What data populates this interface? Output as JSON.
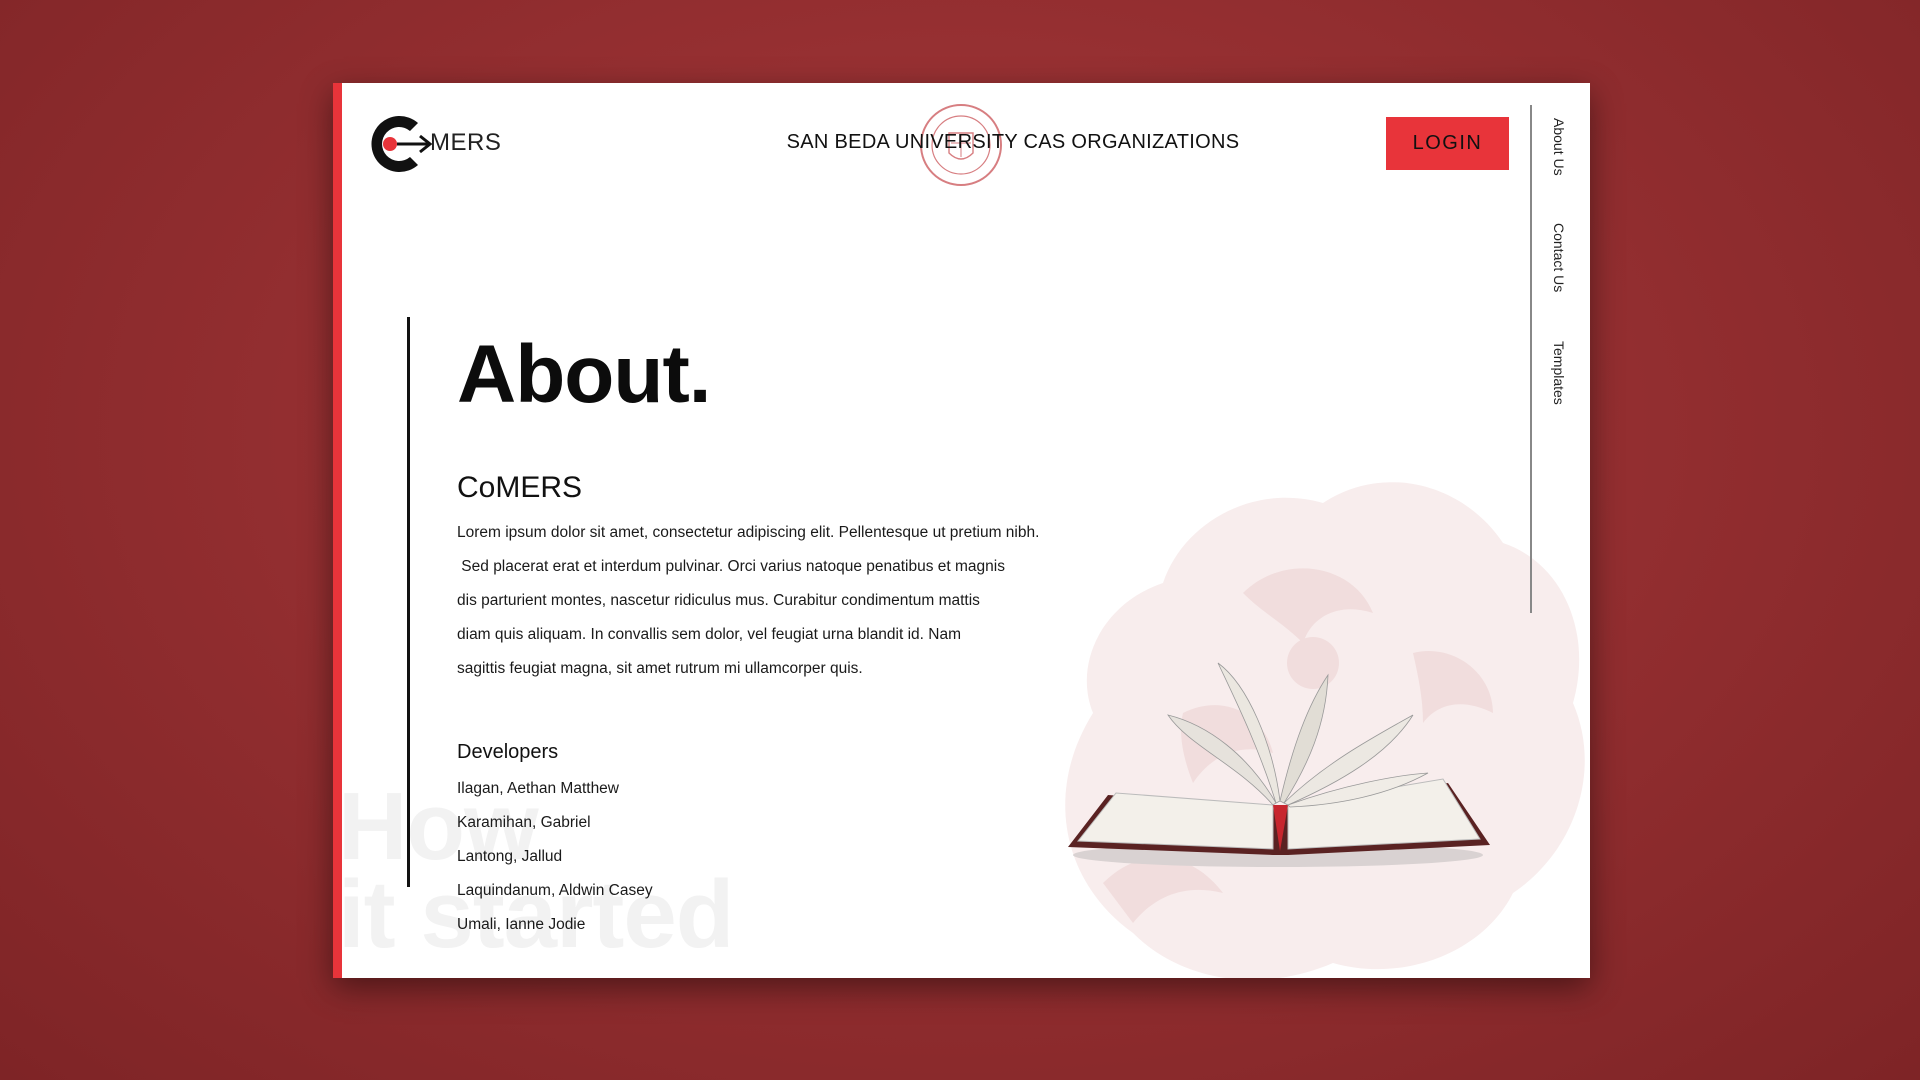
{
  "header": {
    "logo_text": "MERS",
    "org_title": "SAN BEDA UNIVERSITY CAS ORGANIZATIONS",
    "login_label": "LOGIN"
  },
  "side_nav": {
    "items": [
      "About Us",
      "Contact Us",
      "Templates"
    ]
  },
  "main": {
    "title": "About.",
    "section_heading": "CoMERS",
    "paragraph_lines": [
      "Lorem ipsum dolor sit amet, consectetur adipiscing elit. Pellentesque ut pretium nibh.",
      " Sed placerat erat et interdum pulvinar. Orci varius natoque penatibus et magnis",
      "dis parturient montes, nascetur ridiculus mus. Curabitur condimentum mattis",
      "diam quis aliquam. In convallis sem dolor, vel feugiat urna blandit id. Nam",
      "sagittis feugiat magna, sit amet rutrum mi ullamcorper quis."
    ],
    "developers_heading": "Developers",
    "developers": [
      "Ilagan, Aethan Matthew",
      "Karamihan, Gabriel",
      "Lantong, Jallud",
      "Laquindanum, Aldwin Casey",
      "Umali, Ianne Jodie"
    ],
    "ghost_text": "How\nit started"
  },
  "colors": {
    "accent": "#e8343a",
    "backdrop": "#952f31",
    "text": "#111111"
  },
  "icons": [
    "comers-logo-icon",
    "university-seal-icon",
    "lion-watermark-icon",
    "open-book-image"
  ]
}
